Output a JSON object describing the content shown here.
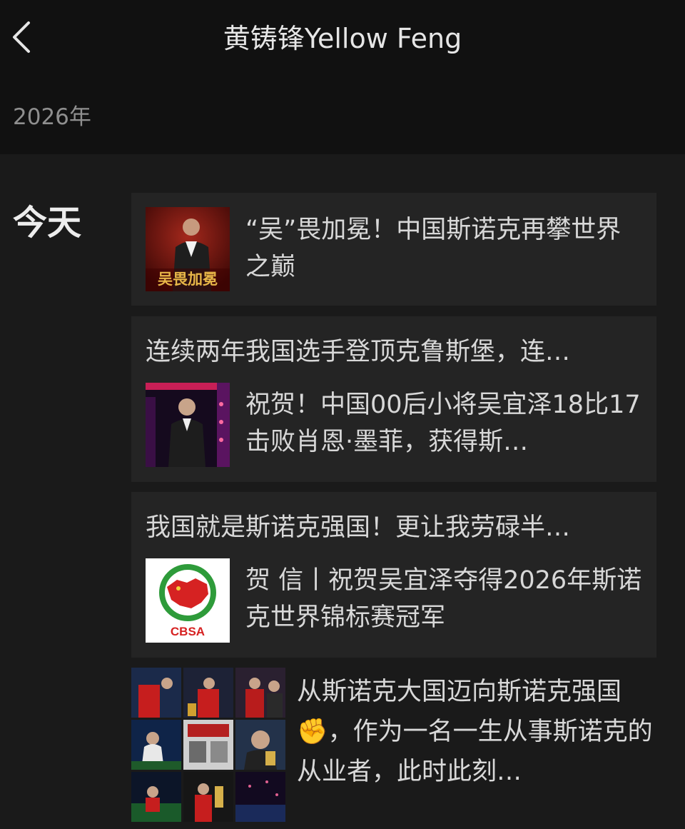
{
  "header": {
    "title": "黄铸锋Yellow Feng",
    "back_icon": "chevron-left-icon"
  },
  "timeline": {
    "year": "2026年",
    "day": "今天"
  },
  "posts": [
    {
      "thumb_caption": "吴畏加冕",
      "text": "“吴”畏加冕！中国斯诺克再攀世界之巅"
    },
    {
      "headline": "连续两年我国选手登顶克鲁斯堡，连…",
      "text": "祝贺！中国00后小将吴宜泽18比17击败肖恩·墨菲，获得斯…"
    },
    {
      "headline": "我国就是斯诺克强国！更让我劳碌半…",
      "logo_text": "CBSA",
      "text": "贺 信丨祝贺吴宜泽夺得2026年斯诺克世界锦标赛冠军"
    },
    {
      "text": "从斯诺克大国迈向斯诺克强国✊，作为一名一生从事斯诺克的从业者，此时此刻…"
    }
  ],
  "colors": {
    "header_bg": "#111111",
    "page_bg": "#1a1a1a",
    "card_bg": "#242424",
    "text": "#d8d8d8",
    "muted": "#8f8f8f"
  }
}
